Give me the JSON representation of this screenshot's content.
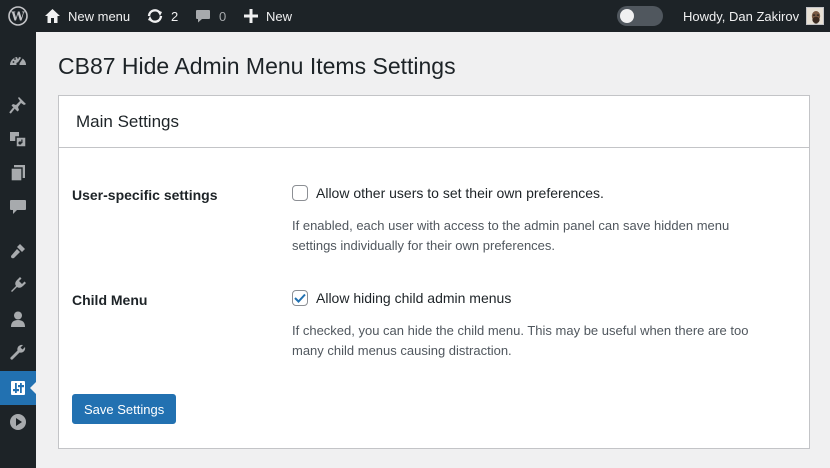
{
  "adminbar": {
    "site_name": "New menu",
    "updates_count": "2",
    "comments_count": "0",
    "new_label": "New",
    "howdy": "Howdy, Dan Zakirov"
  },
  "sidebar": {
    "items": [
      {
        "icon": "dashboard-icon"
      },
      {
        "icon": "pin-icon"
      },
      {
        "icon": "media-icon"
      },
      {
        "icon": "pages-icon"
      },
      {
        "icon": "comments-icon"
      },
      {
        "icon": "appearance-icon"
      },
      {
        "icon": "plugins-icon"
      },
      {
        "icon": "users-icon"
      },
      {
        "icon": "tools-icon"
      },
      {
        "icon": "settings-sliders-icon",
        "current": true
      },
      {
        "icon": "play-icon"
      }
    ]
  },
  "page": {
    "title": "CB87 Hide Admin Menu Items Settings"
  },
  "card": {
    "title": "Main Settings",
    "rows": [
      {
        "label": "User-specific settings",
        "option": "Allow other users to set their own preferences.",
        "checked": false,
        "desc1": "If enabled, each user with access to the admin panel can save hidden menu",
        "desc2": "settings individually for their own preferences."
      },
      {
        "label": "Child Menu",
        "option": "Allow hiding child admin menus",
        "checked": true,
        "desc1": "If checked, you can hide the child menu. This may be useful when there are too",
        "desc2": "many child menus causing distraction."
      }
    ],
    "save_label": "Save Settings"
  },
  "colors": {
    "adminbar_bg": "#1d2327",
    "accent": "#2271b1",
    "page_bg": "#f0f0f1"
  }
}
